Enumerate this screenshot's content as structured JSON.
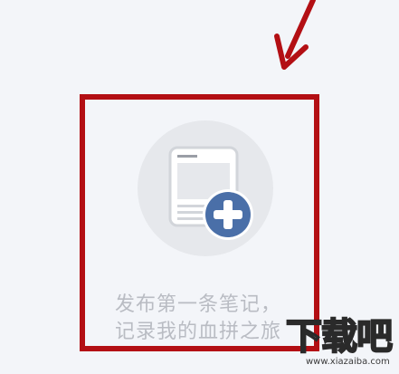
{
  "empty_state": {
    "line1": "发布第一条笔记，",
    "line2": "记录我的血拼之旅",
    "icon": "note-add-icon"
  },
  "annotation": {
    "arrow_color": "#b30f14",
    "box_color": "#b30f14"
  },
  "watermark": {
    "text": "下载吧",
    "url": "www.xiazaiba.com"
  },
  "colors": {
    "background": "#f3f5f9",
    "icon_circle": "#e6e8ec",
    "plus_badge": "#4a6fa8",
    "text_gray": "#b9bcc3"
  }
}
